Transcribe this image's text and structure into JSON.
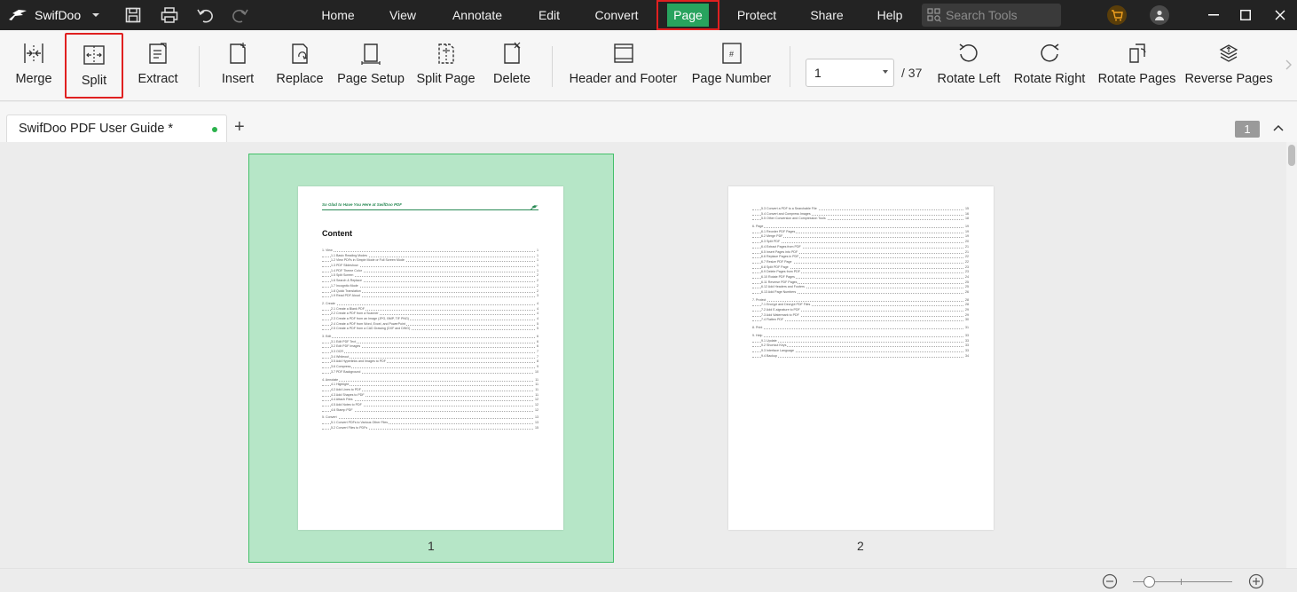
{
  "app": {
    "name": "SwifDoo"
  },
  "menu": [
    {
      "label": "Home"
    },
    {
      "label": "View"
    },
    {
      "label": "Annotate"
    },
    {
      "label": "Edit"
    },
    {
      "label": "Convert"
    },
    {
      "label": "Page"
    },
    {
      "label": "Protect"
    },
    {
      "label": "Share"
    },
    {
      "label": "Help"
    }
  ],
  "search": {
    "placeholder": "Search Tools"
  },
  "ribbon": {
    "merge": "Merge",
    "split": "Split",
    "extract": "Extract",
    "insert": "Insert",
    "replace": "Replace",
    "page_setup": "Page Setup",
    "split_page": "Split Page",
    "delete": "Delete",
    "header_footer": "Header and Footer",
    "page_number": "Page Number",
    "page_input": "1",
    "page_total": "/ 37",
    "rotate_left": "Rotate Left",
    "rotate_right": "Rotate Right",
    "rotate_pages": "Rotate Pages",
    "reverse_pages": "Reverse Pages",
    "page_number_glyph": "#"
  },
  "tabs": {
    "doc_title": "SwifDoo PDF User Guide *",
    "add": "+",
    "page_badge": "1"
  },
  "colors": {
    "accent": "#28a35e",
    "highlight": "#e02020",
    "selection": "#b6e6c7"
  },
  "pages": {
    "p1": {
      "number": "1",
      "header": "So Glad to Have You Here at SwifDoo PDF",
      "title": "Content",
      "toc": [
        {
          "t": "1. View",
          "n": "1",
          "lvl": 0
        },
        {
          "t": "1.1 Basic Reading Modes",
          "n": "1",
          "lvl": 1
        },
        {
          "t": "1.2 View PDFs in Simple Mode or Full Screen Mode",
          "n": "1",
          "lvl": 1
        },
        {
          "t": "1.3 PDF Slideshow",
          "n": "1",
          "lvl": 1
        },
        {
          "t": "1.4 PDF Theme Color",
          "n": "1",
          "lvl": 1
        },
        {
          "t": "1.5 Split Screen",
          "n": "2",
          "lvl": 1
        },
        {
          "t": "1.6 Search & Replace",
          "n": "2",
          "lvl": 1
        },
        {
          "t": "1.7 Incognito Mode",
          "n": "2",
          "lvl": 1
        },
        {
          "t": "1.8 Quick Translation",
          "n": "2",
          "lvl": 1
        },
        {
          "t": "1.9 Read PDF Aloud",
          "n": "3",
          "lvl": 1
        },
        {
          "t": "",
          "n": "",
          "lvl": -1
        },
        {
          "t": "2. Create",
          "n": "4",
          "lvl": 0
        },
        {
          "t": "2.1 Create a Blank PDF",
          "n": "4",
          "lvl": 1
        },
        {
          "t": "2.2 Create a PDF from a Scanner",
          "n": "4",
          "lvl": 1
        },
        {
          "t": "2.3 Create a PDF from an Image (JPG, BMP, TIF PNG)",
          "n": "4",
          "lvl": 1
        },
        {
          "t": "2.4 Create a PDF from Word, Excel, and PowerPoint",
          "n": "5",
          "lvl": 1
        },
        {
          "t": "2.5 Create a PDF from a CAD Drawing (DXF and DWG)",
          "n": "5",
          "lvl": 1
        },
        {
          "t": "",
          "n": "",
          "lvl": -1
        },
        {
          "t": "3. Edit",
          "n": "6",
          "lvl": 0
        },
        {
          "t": "3.1 Edit PDF Text",
          "n": "6",
          "lvl": 1
        },
        {
          "t": "3.2 Edit PDF Images",
          "n": "6",
          "lvl": 1
        },
        {
          "t": "3.3 OCR",
          "n": "7",
          "lvl": 1
        },
        {
          "t": "3.4 Whiteout",
          "n": "7",
          "lvl": 1
        },
        {
          "t": "3.5 Add Hyperlinks and Images to PDF",
          "n": "8",
          "lvl": 1
        },
        {
          "t": "3.6 Compress",
          "n": "9",
          "lvl": 1
        },
        {
          "t": "3.7 PDF Background",
          "n": "10",
          "lvl": 1
        },
        {
          "t": "",
          "n": "",
          "lvl": -1
        },
        {
          "t": "4. Annotate",
          "n": "11",
          "lvl": 0
        },
        {
          "t": "4.1 Highlight",
          "n": "11",
          "lvl": 1
        },
        {
          "t": "4.2 Add Lines to PDF",
          "n": "11",
          "lvl": 1
        },
        {
          "t": "4.3 Add Shapes to PDF",
          "n": "11",
          "lvl": 1
        },
        {
          "t": "4.4 Attach Files",
          "n": "12",
          "lvl": 1
        },
        {
          "t": "4.5 Add Notes to PDF",
          "n": "12",
          "lvl": 1
        },
        {
          "t": "4.6 Stamp PDF",
          "n": "12",
          "lvl": 1
        },
        {
          "t": "",
          "n": "",
          "lvl": -1
        },
        {
          "t": "5. Convert",
          "n": "13",
          "lvl": 0
        },
        {
          "t": "5.1 Convert PDFs to Various Other Files",
          "n": "13",
          "lvl": 1
        },
        {
          "t": "5.2 Convert Files to PDFs",
          "n": "15",
          "lvl": 1
        }
      ]
    },
    "p2": {
      "number": "2",
      "toc": [
        {
          "t": "5.3 Convert a PDF to a Searchable File",
          "n": "15",
          "lvl": 1
        },
        {
          "t": "5.4 Convert and Compress Images",
          "n": "16",
          "lvl": 1
        },
        {
          "t": "5.5 Other Conversion and Compression Tools",
          "n": "18",
          "lvl": 1
        },
        {
          "t": "",
          "n": "",
          "lvl": -1
        },
        {
          "t": "6. Page",
          "n": "19",
          "lvl": 0
        },
        {
          "t": "6.1 Reorder PDF Pages",
          "n": "19",
          "lvl": 1
        },
        {
          "t": "6.2 Merge PDF",
          "n": "19",
          "lvl": 1
        },
        {
          "t": "6.3 Split PDF",
          "n": "20",
          "lvl": 1
        },
        {
          "t": "6.4 Extract Pages from PDF",
          "n": "21",
          "lvl": 1
        },
        {
          "t": "6.5 Insert Pages into PDF",
          "n": "21",
          "lvl": 1
        },
        {
          "t": "6.6 Replace Pages in PDF",
          "n": "22",
          "lvl": 1
        },
        {
          "t": "6.7 Resize PDF Page",
          "n": "22",
          "lvl": 1
        },
        {
          "t": "6.8 Split PDF Page",
          "n": "23",
          "lvl": 1
        },
        {
          "t": "6.9 Delete Pages from PDF",
          "n": "23",
          "lvl": 1
        },
        {
          "t": "6.10 Rotate PDF Pages",
          "n": "24",
          "lvl": 1
        },
        {
          "t": "6.11 Reverse PDF Pages",
          "n": "25",
          "lvl": 1
        },
        {
          "t": "6.12 Add Headers and Footers",
          "n": "25",
          "lvl": 1
        },
        {
          "t": "6.13 Add Page Numbers",
          "n": "26",
          "lvl": 1
        },
        {
          "t": "",
          "n": "",
          "lvl": -1
        },
        {
          "t": "7. Protect",
          "n": "28",
          "lvl": 0
        },
        {
          "t": "7.1 Encrypt and Decrypt PDF Files",
          "n": "28",
          "lvl": 1
        },
        {
          "t": "7.2 Add E-signature to PDF",
          "n": "29",
          "lvl": 1
        },
        {
          "t": "7.3 Add Watermark to PDF",
          "n": "29",
          "lvl": 1
        },
        {
          "t": "7.4 Flatten PDF",
          "n": "30",
          "lvl": 1
        },
        {
          "t": "",
          "n": "",
          "lvl": -1
        },
        {
          "t": "8. Print",
          "n": "31",
          "lvl": 0
        },
        {
          "t": "",
          "n": "",
          "lvl": -1
        },
        {
          "t": "9. Help",
          "n": "33",
          "lvl": 0
        },
        {
          "t": "9.1 Update",
          "n": "33",
          "lvl": 1
        },
        {
          "t": "9.2 Shortcut Keys",
          "n": "33",
          "lvl": 1
        },
        {
          "t": "9.3 Interface Language",
          "n": "33",
          "lvl": 1
        },
        {
          "t": "9.4 Backup",
          "n": "34",
          "lvl": 1
        }
      ]
    }
  }
}
